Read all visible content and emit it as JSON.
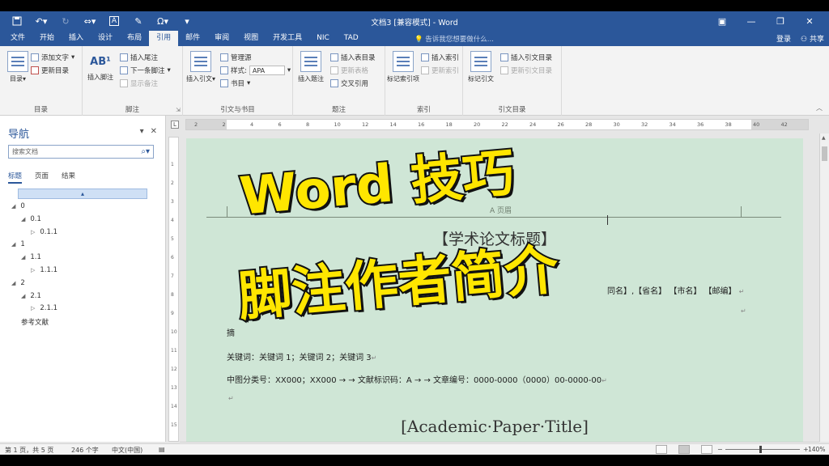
{
  "window": {
    "doc_title": "文档3 [兼容模式] - Word"
  },
  "qat": {
    "icons": [
      "save-icon",
      "undo-icon",
      "redo-icon",
      "customize-icon"
    ],
    "symbol_label": "Ω",
    "touch_label": "A"
  },
  "tabs": [
    "文件",
    "开始",
    "插入",
    "设计",
    "布局",
    "引用",
    "邮件",
    "审阅",
    "视图",
    "开发工具",
    "NIC",
    "TAD"
  ],
  "active_tab": "引用",
  "tell_me": "告诉我您想要做什么...",
  "account": {
    "login": "登录",
    "share": "共享"
  },
  "ribbon": {
    "toc": {
      "big": "目录",
      "add_text": "添加文字",
      "update": "更新目录",
      "label": "目录"
    },
    "footnotes": {
      "big": "插入脚注",
      "insert_endnote": "插入尾注",
      "next_footnote": "下一条脚注",
      "show_notes": "显示备注",
      "label": "脚注",
      "ab_icon": "AB¹"
    },
    "citations": {
      "big": "插入引文",
      "manage": "管理源",
      "style_label": "样式:",
      "style_value": "APA",
      "bibliography": "书目",
      "label": "引文与书目"
    },
    "captions": {
      "big": "插入题注",
      "insert_table_figures": "插入表目录",
      "update_table": "更新表格",
      "cross_ref": "交叉引用",
      "label": "题注"
    },
    "index": {
      "big": "标记索引项",
      "insert_index": "插入索引",
      "update_index": "更新索引",
      "label": "索引"
    },
    "toa": {
      "big": "标记引文",
      "insert_toa": "插入引文目录",
      "update_toa": "更新引文目录",
      "label": "引文目录"
    }
  },
  "nav": {
    "title": "导航",
    "search_placeholder": "搜索文档",
    "tabs": [
      "标题",
      "页面",
      "结果"
    ],
    "items": [
      {
        "label": "0",
        "level": 0
      },
      {
        "label": "0.1",
        "level": 1
      },
      {
        "label": "0.1.1",
        "level": 2
      },
      {
        "label": "1",
        "level": 0
      },
      {
        "label": "1.1",
        "level": 1
      },
      {
        "label": "1.1.1",
        "level": 2
      },
      {
        "label": "2",
        "level": 0
      },
      {
        "label": "2.1",
        "level": 1
      },
      {
        "label": "2.1.1",
        "level": 2
      },
      {
        "label": "参考文献",
        "level": 0
      }
    ]
  },
  "ruler": {
    "ticks": [
      "2",
      "2",
      "4",
      "6",
      "8",
      "10",
      "12",
      "14",
      "16",
      "18",
      "20",
      "22",
      "24",
      "26",
      "28",
      "30",
      "32",
      "34",
      "36",
      "38",
      "40",
      "42"
    ],
    "vticks": [
      "1",
      "2",
      "3",
      "4",
      "5",
      "6",
      "7",
      "8",
      "9",
      "10",
      "11",
      "12",
      "13",
      "14",
      "15"
    ]
  },
  "document": {
    "header_text": "A 页眉",
    "title": "【学术论文标题】",
    "author_line": "同名】,【省名】 【市名】 【邮编】",
    "abstract_mark": "摘",
    "keywords": "关键词：关键词 1；关键词 2；关键词 3",
    "classification": "中图分类号：XX000；XX000 →   →   文献标识码：A →   →   文章编号：0000-0000（0000）00-0000-00",
    "english_title": "[Academic·Paper·Title]"
  },
  "overlay": {
    "line1": "Word 技巧",
    "line2": "脚注作者简介",
    "color": "#ffe600"
  },
  "status": {
    "page": "第 1 页，共 5 页",
    "words": "246 个字",
    "language": "中文(中国)",
    "zoom": "140%",
    "zoom_minus": "−",
    "zoom_plus": "+"
  },
  "colors": {
    "accent": "#2b579a",
    "page_bg": "#cfe6d6"
  }
}
